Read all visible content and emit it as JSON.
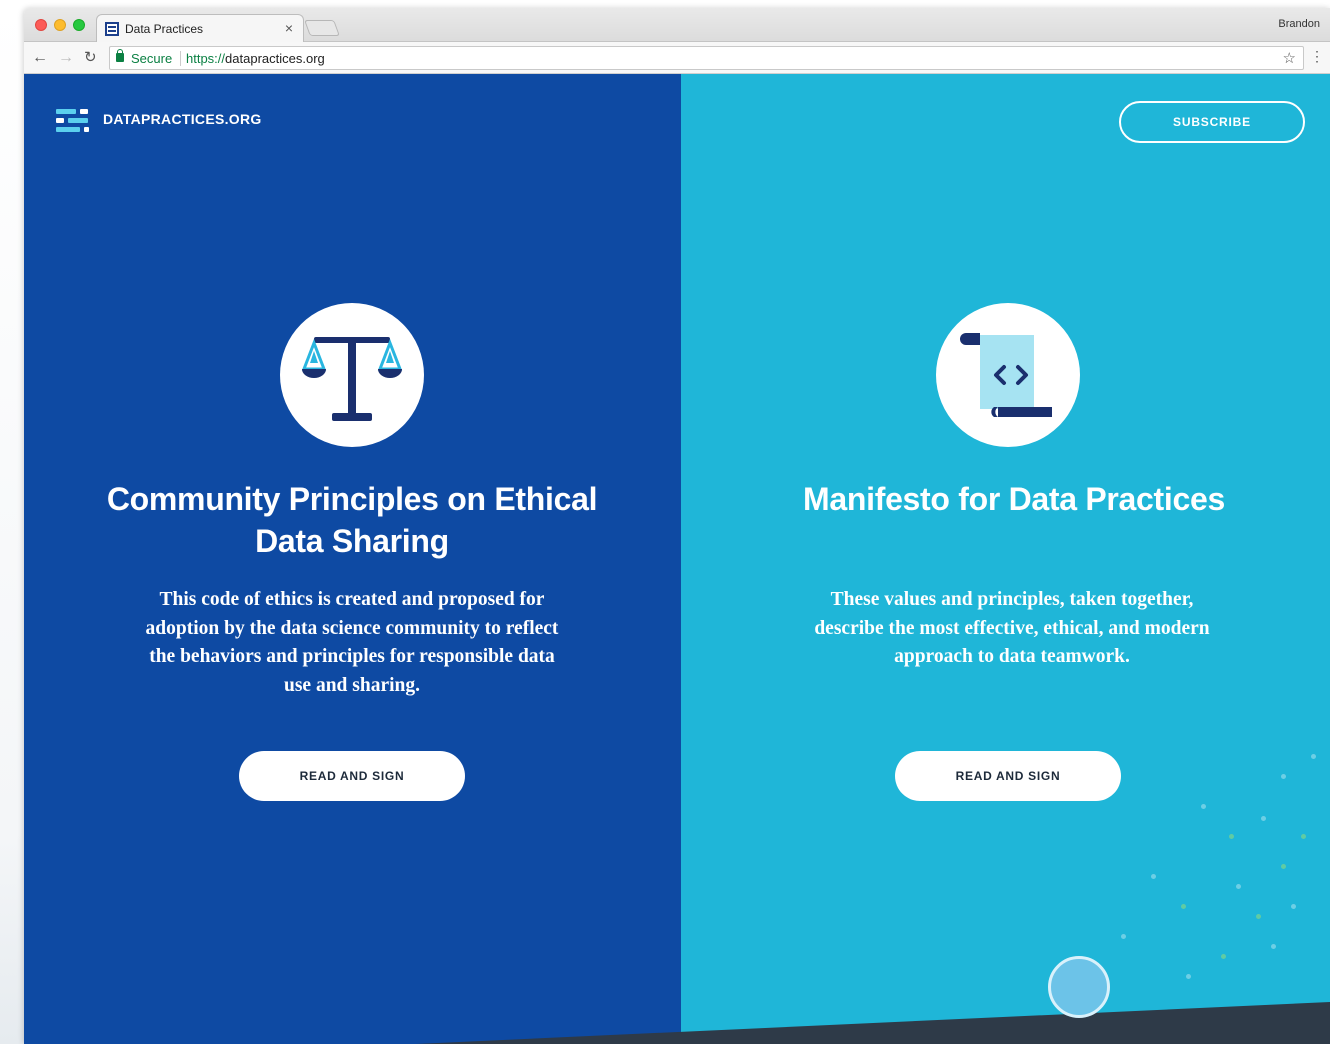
{
  "browser": {
    "tab_title": "Data Practices",
    "tab_close": "×",
    "profile_name": "Brandon",
    "secure_label": "Secure",
    "url_scheme": "https://",
    "url_host": "datapractices.org"
  },
  "header": {
    "brand": "DATAPRACTICES.ORG",
    "subscribe_label": "SUBSCRIBE"
  },
  "cards": {
    "left": {
      "icon": "scales-of-justice-icon",
      "title": "Community Principles on Ethical Data Sharing",
      "description": "This code of ethics is created and proposed for adoption by the data science community to reflect the behaviors and principles for responsible data use and sharing.",
      "button": "READ AND SIGN"
    },
    "right": {
      "icon": "code-scroll-icon",
      "title": "Manifesto for Data Practices",
      "description": "These values and principles, taken together, describe the most effective, ethical, and modern approach to data teamwork.",
      "button": "READ AND SIGN"
    }
  },
  "colors": {
    "left_panel": "#0e4aa3",
    "right_panel": "#1fb6d8",
    "footer_band": "#2e3a48"
  }
}
